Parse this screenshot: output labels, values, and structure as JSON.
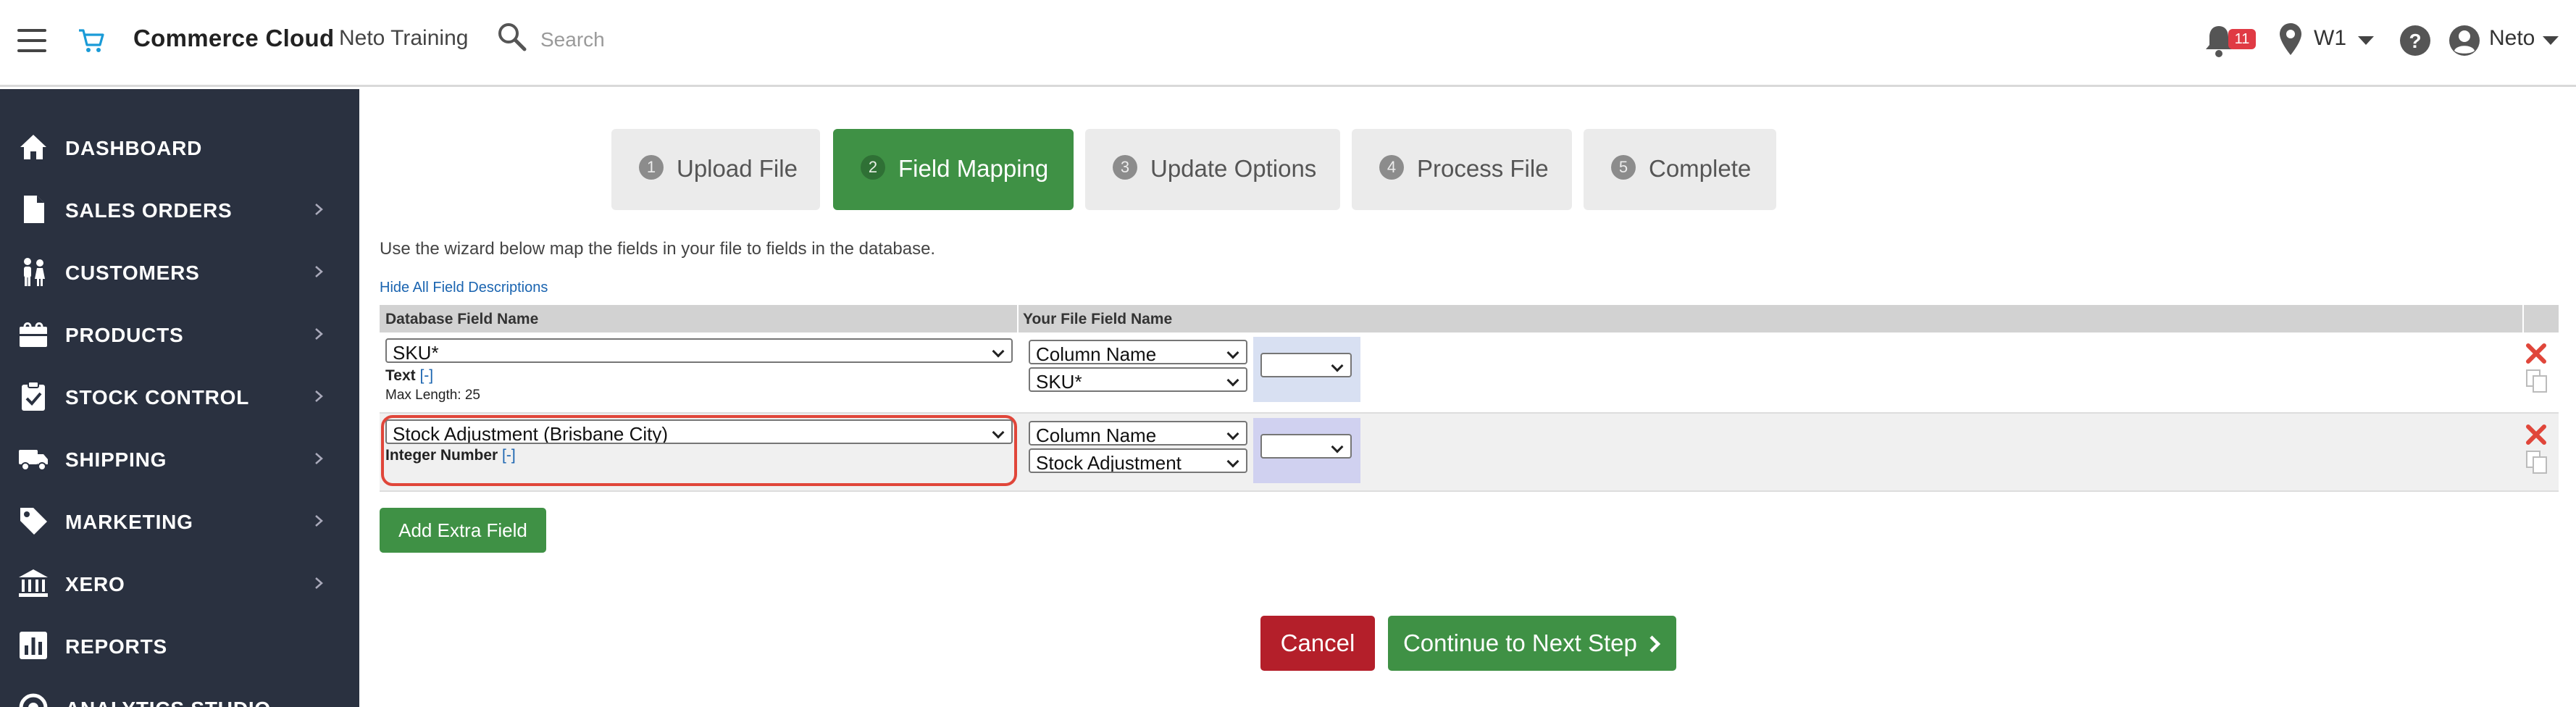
{
  "header": {
    "brand": "Commerce Cloud",
    "store": "Neto Training",
    "search_placeholder": "Search",
    "notification_count": "11",
    "location": "W1",
    "user": "Neto"
  },
  "sidebar": {
    "items": [
      {
        "label": "DASHBOARD",
        "icon": "home-icon"
      },
      {
        "label": "SALES ORDERS",
        "icon": "document-icon"
      },
      {
        "label": "CUSTOMERS",
        "icon": "people-icon"
      },
      {
        "label": "PRODUCTS",
        "icon": "box-icon"
      },
      {
        "label": "STOCK CONTROL",
        "icon": "clipboard-icon"
      },
      {
        "label": "SHIPPING",
        "icon": "truck-icon"
      },
      {
        "label": "MARKETING",
        "icon": "tag-icon"
      },
      {
        "label": "XERO",
        "icon": "bank-icon"
      },
      {
        "label": "REPORTS",
        "icon": "chart-icon"
      },
      {
        "label": "ANALYTICS STUDIO",
        "icon": "analytics-icon"
      }
    ]
  },
  "wizard": {
    "steps": [
      {
        "num": "1",
        "label": "Upload File",
        "active": false
      },
      {
        "num": "2",
        "label": "Field Mapping",
        "active": true
      },
      {
        "num": "3",
        "label": "Update Options",
        "active": false
      },
      {
        "num": "4",
        "label": "Process File",
        "active": false
      },
      {
        "num": "5",
        "label": "Complete",
        "active": false
      }
    ]
  },
  "content": {
    "intro": "Use the wizard below map the fields in your file to fields in the database.",
    "hide_link": "Hide All Field Descriptions",
    "col_db": "Database Field Name",
    "col_file": "Your File Field Name",
    "rows": [
      {
        "db_field": "SKU*",
        "type": "Text",
        "toggle": "[-]",
        "max_length": "Max Length: 25",
        "map_type": "Column Name",
        "map_column": "SKU*"
      },
      {
        "db_field": "Stock Adjustment (Brisbane City)",
        "type": "Integer Number",
        "toggle": "[-]",
        "map_type": "Column Name",
        "map_column": "Stock Adjustment"
      }
    ],
    "add_button": "Add Extra Field",
    "cancel_button": "Cancel",
    "next_button": "Continue to Next Step"
  },
  "colors": {
    "sidebar_bg": "#2a3140",
    "primary_green": "#3f9145",
    "cancel_red": "#b41f2a",
    "accent_blue": "#1a9bd7",
    "highlight_red": "#e0463a"
  }
}
